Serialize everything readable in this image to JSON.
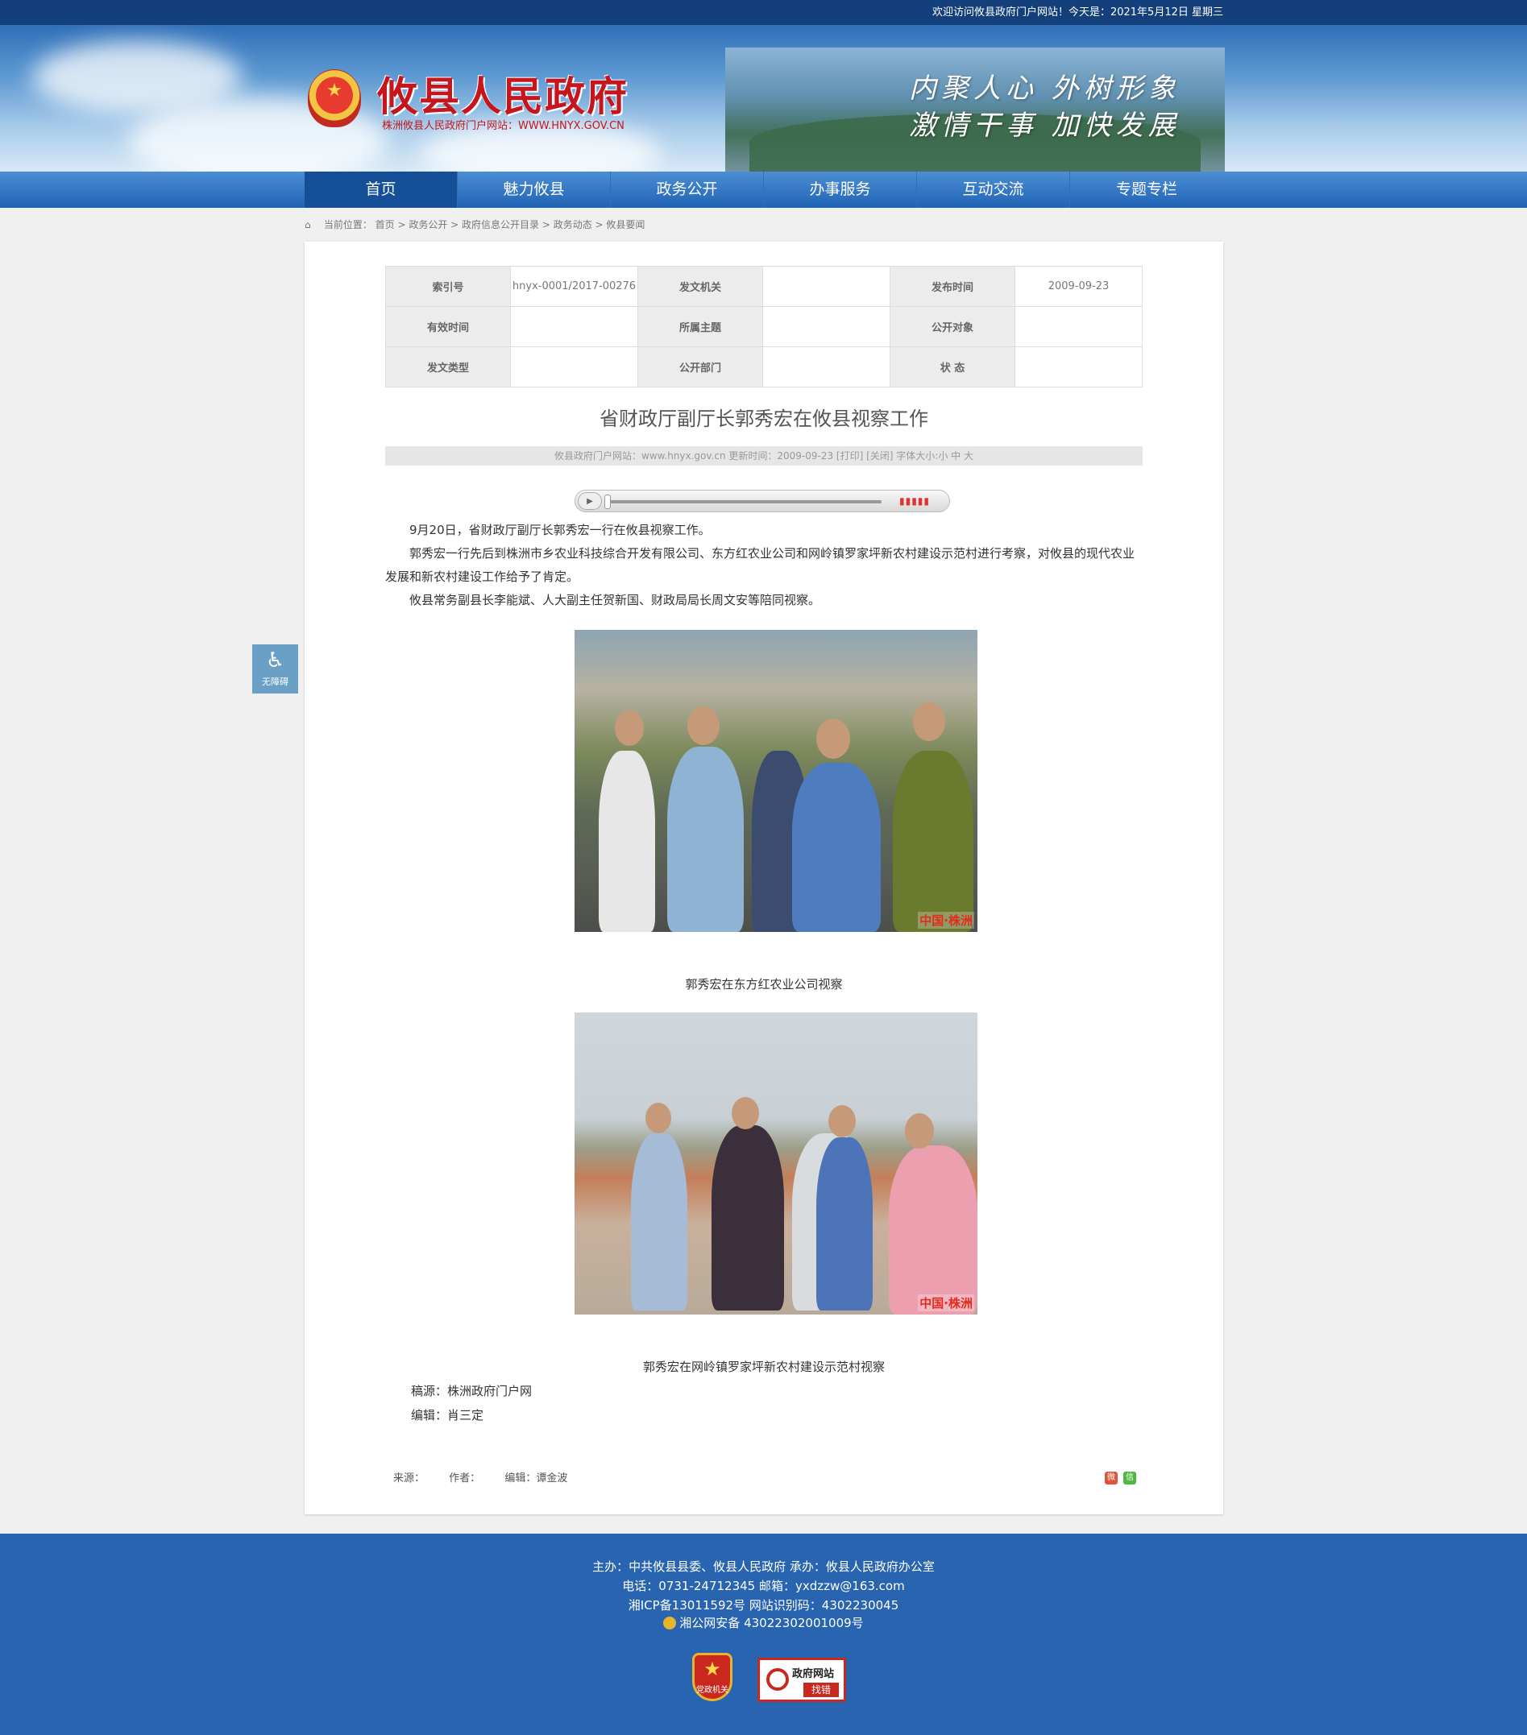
{
  "topbar": {
    "greeting": "欢迎访问攸县政府门户网站！今天是：2021年5月12日 星期三"
  },
  "header": {
    "site_title": "攸县人民政府",
    "site_subtitle": "株洲攸县人民政府门户网站：WWW.HNYX.GOV.CN",
    "slogan_line1": "内聚人心 外树形象",
    "slogan_line2": "激情干事 加快发展"
  },
  "nav": {
    "items": [
      "首页",
      "魅力攸县",
      "政务公开",
      "办事服务",
      "互动交流",
      "专题专栏"
    ],
    "active": "首页"
  },
  "breadcrumb": {
    "prefix": "当前位置：",
    "path": "首页 > 政务公开 > 政府信息公开目录 > 政务动态 > 攸县要闻"
  },
  "meta_table": {
    "index_label": "索引号",
    "index_value": "hnyx-0001/2017-00276",
    "issuer_label": "发文机关",
    "issuer_value": "",
    "publish_label": "发布时间",
    "publish_value": "2009-09-23",
    "valid_label": "有效时间",
    "valid_value": "",
    "topic_label": "所属主题",
    "topic_value": "",
    "audience_label": "公开对象",
    "audience_value": "",
    "doctype_label": "发文类型",
    "doctype_value": "",
    "dept_label": "公开部门",
    "dept_value": "",
    "status_label": "状 态",
    "status_value": ""
  },
  "article": {
    "title": "省财政厅副厅长郭秀宏在攸县视察工作",
    "info": "攸县政府门户网站：www.hnyx.gov.cn  更新时间：2009-09-23  [打印] [关闭]  字体大小:小 中 大",
    "paragraphs": [
      "9月20日，省财政厅副厅长郭秀宏一行在攸县视察工作。",
      "郭秀宏一行先后到株洲市乡农业科技综合开发有限公司、东方红农业公司和网岭镇罗家坪新农村建设示范村进行考察，对攸县的现代农业发展和新农村建设工作给予了肯定。",
      "攸县常务副县长李能斌、人大副主任贺新国、财政局局长周文安等陪同视察。"
    ],
    "caption1": "郭秀宏在东方红农业公司视察",
    "caption2": "郭秀宏在网岭镇罗家坪新农村建设示范村视察",
    "watermark": "中国·株洲",
    "credit_source": "稿源：株洲政府门户网",
    "credit_editor": "编辑：肖三定"
  },
  "source_bar": {
    "source": "来源：",
    "author": "作者：",
    "editor": "编辑：谭金波"
  },
  "accessibility": {
    "label": "无障碍"
  },
  "footer": {
    "line1": "主办：中共攸县县委、攸县人民政府 承办：攸县人民政府办公室",
    "line2": "电话：0731-24712345 邮箱：yxdzzw@163.com",
    "line3": "湘ICP备13011592号    网站识别码：4302230045",
    "line4": "湘公网安备 43022302001009号",
    "badge1": "党政机关",
    "badge2_title": "政府网站",
    "badge2_action": "找错"
  }
}
